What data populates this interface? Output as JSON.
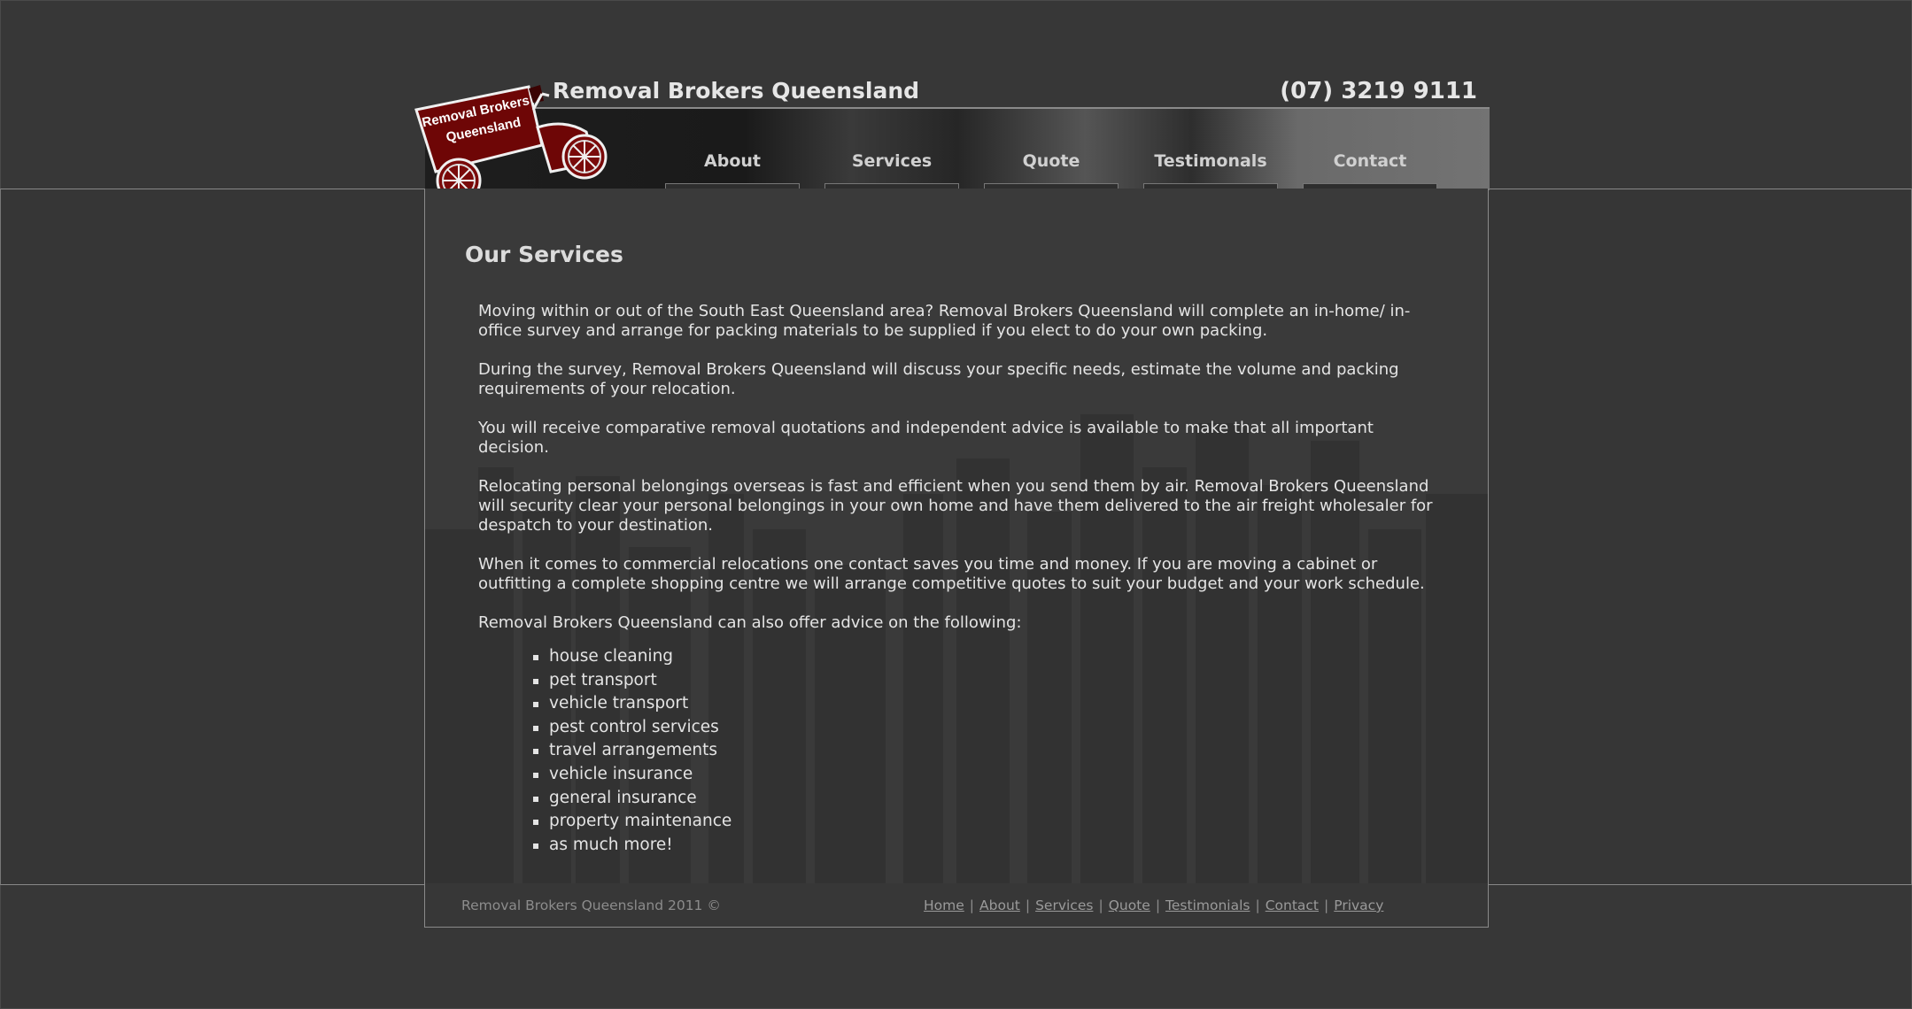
{
  "header": {
    "site_title": "Removal Brokers Queensland",
    "phone": "(07) 3219 9111",
    "logo_text_line1": "Removal Brokers",
    "logo_text_line2": "Queensland"
  },
  "nav": {
    "items": [
      {
        "label": "About"
      },
      {
        "label": "Services"
      },
      {
        "label": "Quote"
      },
      {
        "label": "Testimonals"
      },
      {
        "label": "Contact"
      }
    ]
  },
  "main": {
    "heading": "Our Services",
    "paragraphs": [
      "Moving within or out of the South East Queensland area? Removal Brokers Queensland will complete an in-home/ in-office survey and arrange for packing materials to be supplied if you elect to do your own packing.",
      "During the survey, Removal Brokers Queensland will discuss your specific needs, estimate the volume and packing requirements of your relocation.",
      "You will receive comparative removal quotations and independent advice is available to make that all important decision.",
      "Relocating personal belongings overseas is fast and efficient when you send them by air. Removal Brokers Queensland will security clear your personal belongings in your own home and have them delivered to the air freight wholesaler for despatch to your destination.",
      "When it comes to commercial relocations one contact saves you time and money. If you are moving a cabinet or outfitting a complete shopping centre we will arrange competitive quotes to suit your budget and your work schedule.",
      "Removal Brokers Queensland can also offer advice on the following:"
    ],
    "list": [
      "house cleaning",
      "pet transport",
      "vehicle transport",
      "pest control services",
      "travel arrangements",
      "vehicle insurance",
      "general insurance",
      "property maintenance",
      "as much more!"
    ]
  },
  "footer": {
    "copyright": "Removal Brokers Queensland 2011 ©",
    "links": [
      "Home",
      "About",
      "Services",
      "Quote",
      "Testimonials",
      "Contact",
      "Privacy"
    ],
    "separator": "|"
  },
  "colors": {
    "background": "#373737",
    "logo_red": "#7a0a0a",
    "text": "#e4e4e4"
  }
}
